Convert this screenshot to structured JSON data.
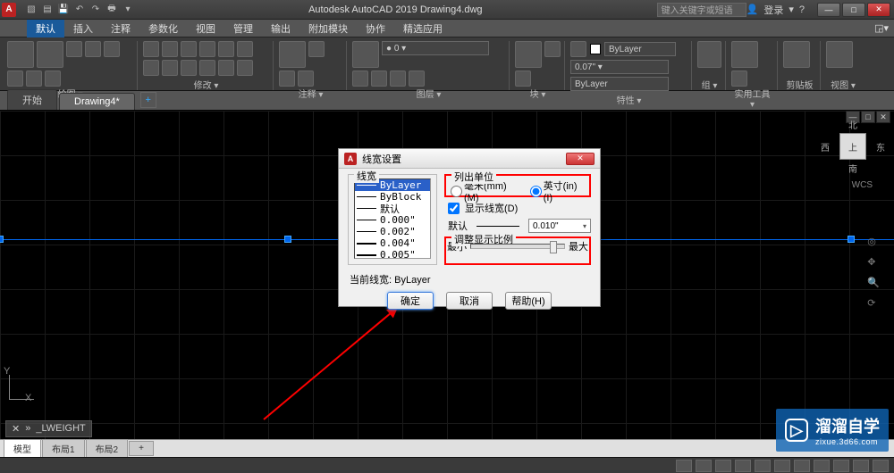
{
  "titlebar": {
    "app_icon": "A",
    "title": "Autodesk AutoCAD 2019   Drawing4.dwg",
    "search_placeholder": "键入关键字或短语",
    "login_label": "登录"
  },
  "menubar": {
    "items": [
      "默认",
      "插入",
      "注释",
      "参数化",
      "视图",
      "管理",
      "输出",
      "附加模块",
      "协作",
      "精选应用"
    ]
  },
  "ribbon": {
    "panels": [
      "绘图 ▾",
      "修改 ▾",
      "注释 ▾",
      "图层 ▾",
      "块 ▾",
      "特性 ▾",
      "组 ▾",
      "实用工具 ▾",
      "剪贴板",
      "视图 ▾"
    ],
    "bylayer": "ByLayer",
    "linewidth_sample": "0.07\" ▾"
  },
  "tabs": {
    "start": "开始",
    "doc": "Drawing4*",
    "plus": "+"
  },
  "viewcube": {
    "top": "上",
    "n": "北",
    "s": "南",
    "e": "东",
    "w": "西",
    "wcs": "WCS"
  },
  "cmdline": {
    "prompt": "_LWEIGHT",
    "chev": "»"
  },
  "dialog": {
    "title": "线宽设置",
    "legend_lw": "线宽",
    "lw_items": [
      "ByLayer",
      "ByBlock",
      "默认",
      "0.000\"",
      "0.002\"",
      "0.004\"",
      "0.005\""
    ],
    "legend_units": "列出单位",
    "unit_mm": "毫米(mm)(M)",
    "unit_in": "英寸(in)(I)",
    "show_lw": "显示线宽(D)",
    "default_label": "默认",
    "default_value": "0.010\"",
    "legend_scale": "调整显示比例",
    "min": "最小",
    "max": "最大",
    "current_label": "当前线宽:",
    "current_value": "ByLayer",
    "ok": "确定",
    "cancel": "取消",
    "help": "帮助(H)"
  },
  "bottomtabs": {
    "items": [
      "模型",
      "布局1",
      "布局2"
    ],
    "plus": "+"
  },
  "watermark": {
    "brand": "溜溜自学",
    "sub": "zixue.3d66.com"
  }
}
